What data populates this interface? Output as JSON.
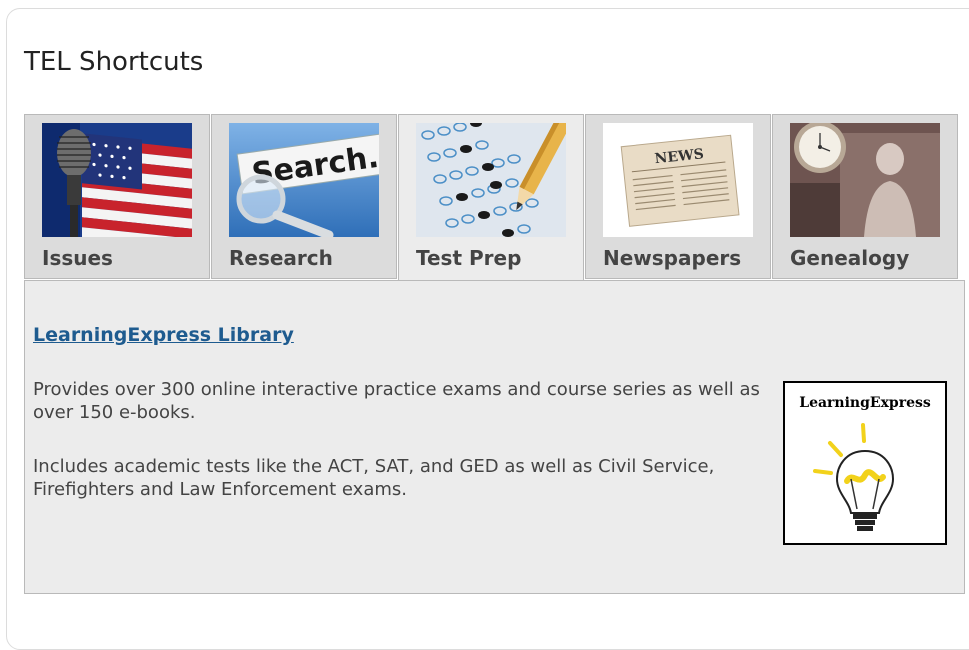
{
  "section": {
    "title": "TEL Shortcuts"
  },
  "tabs": [
    {
      "label": "Issues",
      "image": "microphone-flag-image",
      "active": false
    },
    {
      "label": "Research",
      "image": "search-magnifier-image",
      "active": false
    },
    {
      "label": "Test Prep",
      "image": "answer-sheet-pencil-image",
      "active": true
    },
    {
      "label": "Newspapers",
      "image": "newspaper-image",
      "active": false
    },
    {
      "label": "Genealogy",
      "image": "vintage-photo-pocketwatch-image",
      "active": false
    }
  ],
  "content": {
    "link_label": "LearningExpress Library",
    "paragraph_1": "Provides over 300 online interactive practice exams and course series as well as over 150 e-books.",
    "paragraph_2": "Includes academic tests like the ACT, SAT, and GED as well as Civil Service, Firefighters and Law Enforcement exams.",
    "logo_text": "LearningExpress"
  },
  "colors": {
    "link": "#1e5b8f",
    "tab_inactive": "#dcdcdc",
    "tab_active": "#ececec",
    "border": "#b9b9b9"
  }
}
